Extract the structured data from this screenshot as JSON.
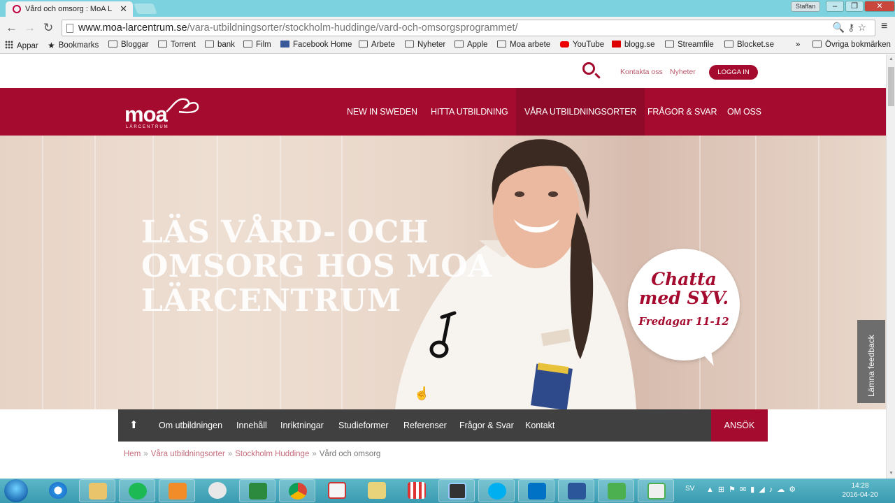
{
  "browser": {
    "tab_title": "Vård och omsorg : MoA L",
    "user_badge": "Staffan",
    "url_host": "www.moa-larcentrum.se",
    "url_path": "/vara-utbildningsorter/stockholm-huddinge/vard-och-omsorgsprogrammet/",
    "bookmarks": [
      "Appar",
      "Bookmarks",
      "Bloggar",
      "Torrent",
      "bank",
      "Film",
      "Facebook Home",
      "Arbete",
      "Nyheter",
      "Apple",
      "Moa arbete",
      "YouTube",
      "blogg.se",
      "Streamfile",
      "Blocket.se"
    ],
    "bookmarks_overflow": "»",
    "other_bookmarks": "Övriga bokmärken"
  },
  "site": {
    "utility_links": [
      "Kontakta oss",
      "Nyheter"
    ],
    "login_label": "LOGGA IN",
    "logo_text": "moa",
    "logo_sub": "LÄRCENTRUM",
    "nav": [
      "NEW IN SWEDEN",
      "HITTA UTBILDNING",
      "VÅRA UTBILDNINGSORTER",
      "FRÅGOR & SVAR",
      "OM OSS"
    ],
    "active_nav_index": 2,
    "hero_title": "LÄS VÅRD- OCH OMSORG HOS MOA LÄRCENTRUM",
    "chat_bubble": {
      "line1": "Chatta med SYV.",
      "line2": "Fredagar 11-12"
    },
    "feedback_label": "Lämna feedback",
    "subnav": [
      "Om utbildningen",
      "Innehåll",
      "Inriktningar",
      "Studieformer",
      "Referenser",
      "Frågor & Svar",
      "Kontakt"
    ],
    "apply_label": "ANSÖK",
    "breadcrumb": [
      "Hem",
      "Våra utbildningsorter",
      "Stockholm Huddinge",
      "Vård och omsorg"
    ],
    "breadcrumb_sep": "»",
    "brand_color": "#a50b2e"
  },
  "taskbar": {
    "language": "SV",
    "time": "14:28",
    "date": "2016-04-20",
    "apps": [
      "internet-explorer",
      "file-explorer",
      "spotify",
      "media-player",
      "network",
      "stock-app",
      "chrome",
      "notes",
      "editor",
      "popcorn",
      "screen-app",
      "skype",
      "outlook",
      "word",
      "camtasia",
      "camtasia-recorder"
    ]
  }
}
